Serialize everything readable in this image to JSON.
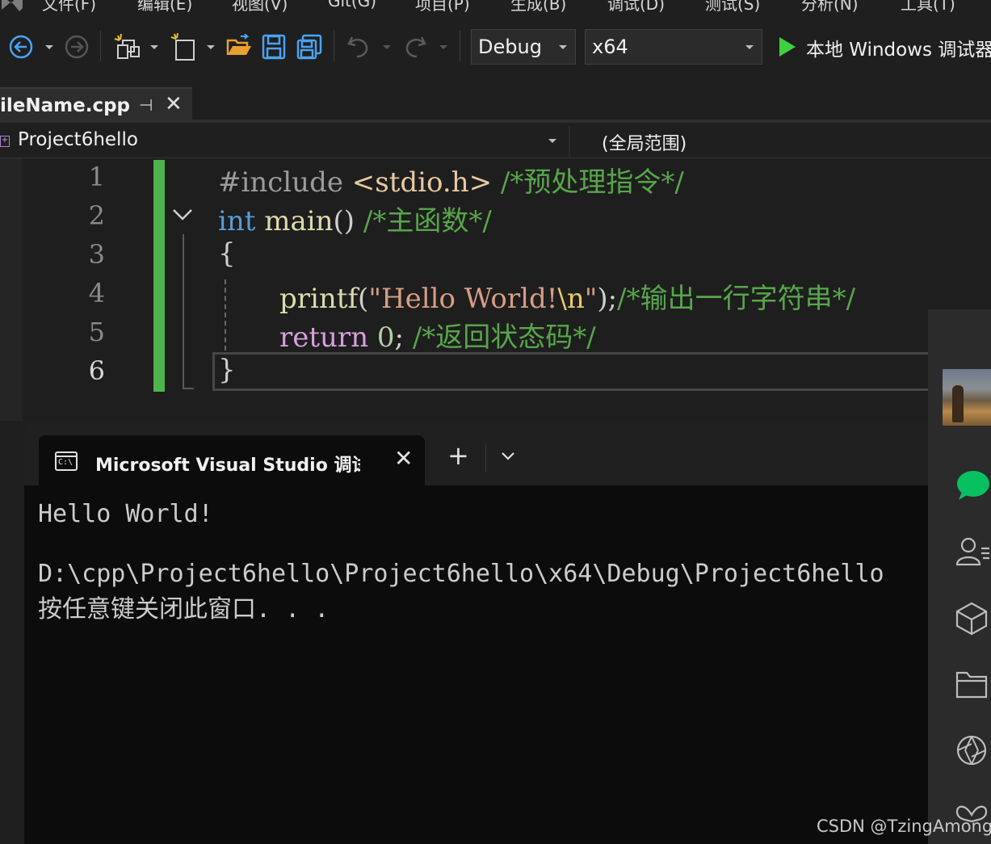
{
  "menu": {
    "items": [
      "文件(F)",
      "编辑(E)",
      "视图(V)",
      "Git(G)",
      "项目(P)",
      "生成(B)",
      "调试(D)",
      "测试(S)",
      "分析(N)",
      "工具(T)"
    ]
  },
  "toolbar": {
    "config": "Debug",
    "platform": "x64",
    "run_label": "本地 Windows 调试器"
  },
  "editor_tab": {
    "filename": "ileName.cpp"
  },
  "navbar": {
    "project": "Project6hello",
    "scope": "(全局范围)"
  },
  "editor": {
    "line_numbers": [
      "1",
      "2",
      "3",
      "4",
      "5",
      "6"
    ],
    "lines": [
      {
        "pp": "#include ",
        "inc": "<stdio.h>",
        "com": " /*预处理指令*/"
      },
      {
        "kw": "int",
        "fn": " main",
        "pn": "()",
        "com": " /*主函数*/"
      },
      {
        "pn": "{"
      },
      {
        "fn": "printf",
        "pn1": "(",
        "str": "\"Hello World!",
        "esc": "\\n",
        "str2": "\"",
        "pn2": ");",
        "com": "/*输出一行字符串*/"
      },
      {
        "kw": "return",
        "num": " 0",
        "pn": ";",
        "com": " /*返回状态码*/"
      },
      {
        "pn": "}"
      }
    ]
  },
  "terminal": {
    "tab_title": "Microsoft Visual Studio 调试控制台",
    "output": [
      "Hello World!",
      "",
      "D:\\cpp\\Project6hello\\Project6hello\\x64\\Debug\\Project6hello",
      "按任意键关闭此窗口. . ."
    ]
  },
  "watermark": "CSDN @TzingAmong",
  "colors": {
    "accent_green": "#4db34d",
    "keyword": "#569cd6",
    "comment": "#57a64a",
    "string": "#d69d85",
    "run": "#3fcf3f",
    "wechat": "#07c160"
  }
}
